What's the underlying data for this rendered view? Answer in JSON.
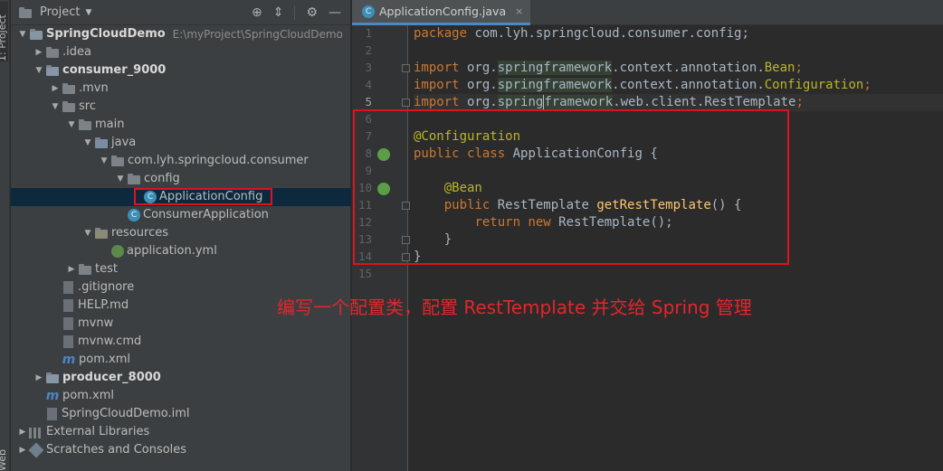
{
  "side_strip": {
    "project_tab": "1: Project",
    "web_tab": "Web"
  },
  "project_panel": {
    "title": "Project",
    "toolbar_icons": [
      "target-icon",
      "collapse-icon",
      "gear-icon",
      "hide-icon"
    ]
  },
  "tree": [
    {
      "label": "SpringCloudDemo",
      "path": "E:\\myProject\\SpringCloudDemo",
      "bold": true,
      "expanded": true
    },
    {
      "label": ".idea"
    },
    {
      "label": "consumer_9000",
      "bold": true
    },
    {
      "label": ".mvn"
    },
    {
      "label": "src"
    },
    {
      "label": "main"
    },
    {
      "label": "java"
    },
    {
      "label": "com.lyh.springcloud.consumer"
    },
    {
      "label": "config"
    },
    {
      "label": "ApplicationConfig",
      "selected": true
    },
    {
      "label": "ConsumerApplication"
    },
    {
      "label": "resources"
    },
    {
      "label": "application.yml"
    },
    {
      "label": "test"
    },
    {
      "label": ".gitignore"
    },
    {
      "label": "HELP.md"
    },
    {
      "label": "mvnw"
    },
    {
      "label": "mvnw.cmd"
    },
    {
      "label": "pom.xml"
    },
    {
      "label": "producer_8000",
      "bold": true
    },
    {
      "label": "pom.xml"
    },
    {
      "label": "SpringCloudDemo.iml"
    },
    {
      "label": "External Libraries"
    },
    {
      "label": "Scratches and Consoles"
    }
  ],
  "editor": {
    "tab_label": "ApplicationConfig.java",
    "tab_close": "×",
    "line_numbers": [
      "1",
      "2",
      "3",
      "4",
      "5",
      "6",
      "7",
      "8",
      "9",
      "10",
      "11",
      "12",
      "13",
      "14",
      "15"
    ],
    "lines": {
      "l1_kw": "package",
      "l1_rest": " com.lyh.springcloud.consumer.config;",
      "l3_kw": "import",
      "l3_a": " org.",
      "l3_b": "springframework",
      "l3_c": ".context.annotation.",
      "l3_d": "Bean",
      "l3_e": ";",
      "l4_kw": "import",
      "l4_a": " org.",
      "l4_b": "springframework",
      "l4_c": ".context.annotation.",
      "l4_d": "Configuration",
      "l4_e": ";",
      "l5_kw": "import",
      "l5_a": " org.",
      "l5_b1": "spring",
      "l5_b2": "framework",
      "l5_c": ".web.client.RestTemplate",
      "l5_e": ";",
      "l7_ann": "@Configuration",
      "l8_kw1": "public",
      "l8_kw2": "class",
      "l8_rest": " ApplicationConfig {",
      "l10_ann": "@Bean",
      "l11_kw": "public",
      "l11_a": " RestTemplate ",
      "l11_fn": "getRestTemplate",
      "l11_b": "() {",
      "l12_kw1": "return",
      "l12_kw2": "new",
      "l12_rest": " RestTemplate();",
      "l13": "}",
      "l14": "}"
    }
  },
  "annotation_text": "编写一个配置类，配置 RestTemplate 并交给 Spring 管理",
  "colors": {
    "highlight_box": "#e0121b",
    "selection": "#0d293e",
    "keyword": "#cc7832",
    "annotation": "#bbb529"
  }
}
